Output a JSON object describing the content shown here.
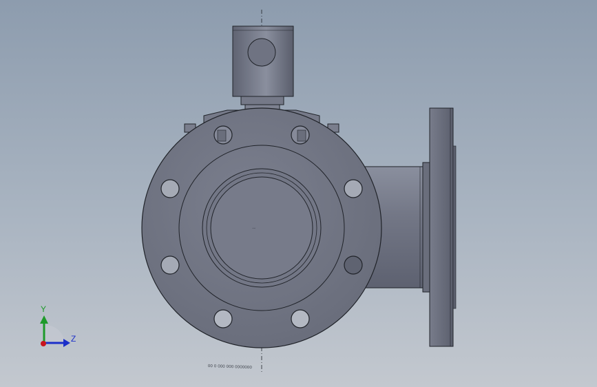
{
  "viewport": {
    "background_top": "#8d9cae",
    "background_bottom": "#c3c8cf"
  },
  "model": {
    "part": "valve-body-with-actuator",
    "body_color": "#6f7382",
    "highlight_color": "#8a8f9e",
    "edge_color": "#1f2228",
    "bolt_hole_count": 8,
    "caption": "00 0 000 000 0000000"
  },
  "triad": {
    "y_label": "Y",
    "z_label": "Z",
    "y_color": "#1e9a2a",
    "z_color": "#1b2fc9",
    "x_color": "#c8141e"
  }
}
